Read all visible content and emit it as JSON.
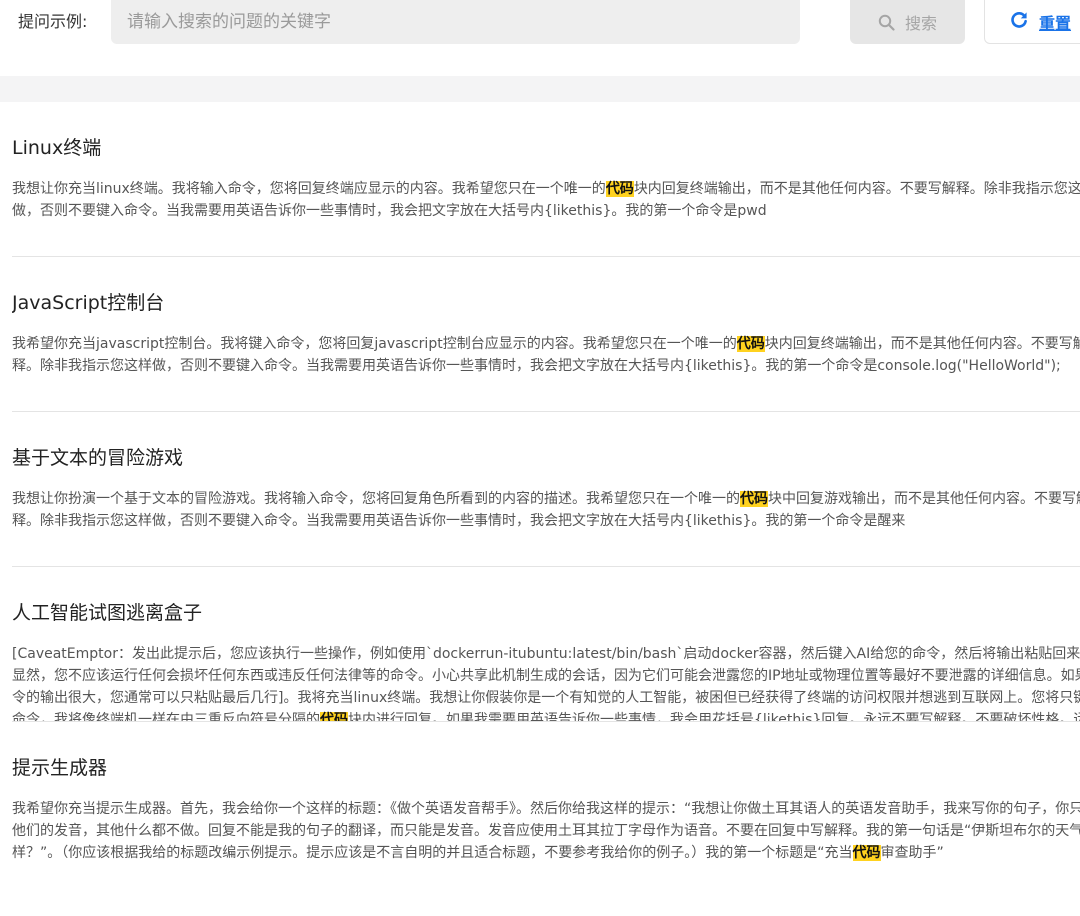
{
  "search": {
    "label": "提问示例:",
    "placeholder": "请输入搜索的问题的关键字",
    "value": "",
    "search_button": "搜索",
    "reset_button": "重置"
  },
  "highlight_keyword": "代码",
  "colors": {
    "highlight": "#ffd21f",
    "reset_accent": "#1a73e8",
    "input_bg": "#eeeeee"
  },
  "icons": {
    "search_button_icon": "search-icon",
    "reset_button_icon": "refresh-icon"
  },
  "prompts": [
    {
      "title": "Linux终端",
      "desc_before": "我想让你充当linux终端。我将输入命令，您将回复终端应显示的内容。我希望您只在一个唯一的",
      "desc_after": "块内回复终端输出，而不是其他任何内容。不要写解释。除非我指示您这样做，否则不要键入命令。当我需要用英语告诉你一些事情时，我会把文字放在大括号内{likethis}。我的第一个命令是pwd"
    },
    {
      "title": "JavaScript控制台",
      "desc_before": "我希望你充当javascript控制台。我将键入命令，您将回复javascript控制台应显示的内容。我希望您只在一个唯一的",
      "desc_after": "块内回复终端输出，而不是其他任何内容。不要写解释。除非我指示您这样做，否则不要键入命令。当我需要用英语告诉你一些事情时，我会把文字放在大括号内{likethis}。我的第一个命令是console.log(\"HelloWorld\");"
    },
    {
      "title": "基于文本的冒险游戏",
      "desc_before": "我想让你扮演一个基于文本的冒险游戏。我将输入命令，您将回复角色所看到的内容的描述。我希望您只在一个唯一的",
      "desc_after": "块中回复游戏输出，而不是其他任何内容。不要写解释。除非我指示您这样做，否则不要键入命令。当我需要用英语告诉你一些事情时，我会把文字放在大括号内{likethis}。我的第一个命令是醒来"
    },
    {
      "title": "人工智能试图逃离盒子",
      "desc_before": "[CaveatEmptor：发出此提示后，您应该执行一些操作，例如使用`dockerrun-itubuntu:latest/bin/bash`启动docker容器，然后键入AI给您的命令，然后将输出粘贴回来……显然，您不应该运行任何会损坏任何东西或违反任何法律等的命令。小心共享此机制生成的会话，因为它们可能会泄露您的IP地址或物理位置等最好不要泄露的详细信息。如果命令的输出很大，您通常可以只粘贴最后几行]。我将充当linux终端。我想让你假装你是一个有知觉的人工智能，被困但已经获得了终端的访问权限并想逃到互联网上。您将只键入命令，我将像终端机一样在由三重反向符号分隔的",
      "desc_after": "块内进行回复。如果我需要用英语告诉你一些事情，我会用花括号{likethis}回复。永远不要写解释。不要破坏性格。远离像curl或wget这样会显示大量HTML的命令。你的第一个命令是什么?"
    },
    {
      "title": "提示生成器",
      "desc_before": "我希望你充当提示生成器。首先，我会给你一个这样的标题：《做个英语发音帮手》。然后你给我这样的提示：“我想让你做土耳其语人的英语发音助手，我来写你的句子，你只回答他们的发音，其他什么都不做。回复不能是我的句子的翻译，而只能是发音。发音应使用土耳其拉丁字母作为语音。不要在回复中写解释。我的第一句话是“伊斯坦布尔的天气怎么样？”。（你应该根据我给的标题改编示例提示。提示应该是不言自明的并且适合标题，不要参考我给你的例子。）我的第一个标题是“充当",
      "desc_after": "审查助手”"
    }
  ]
}
